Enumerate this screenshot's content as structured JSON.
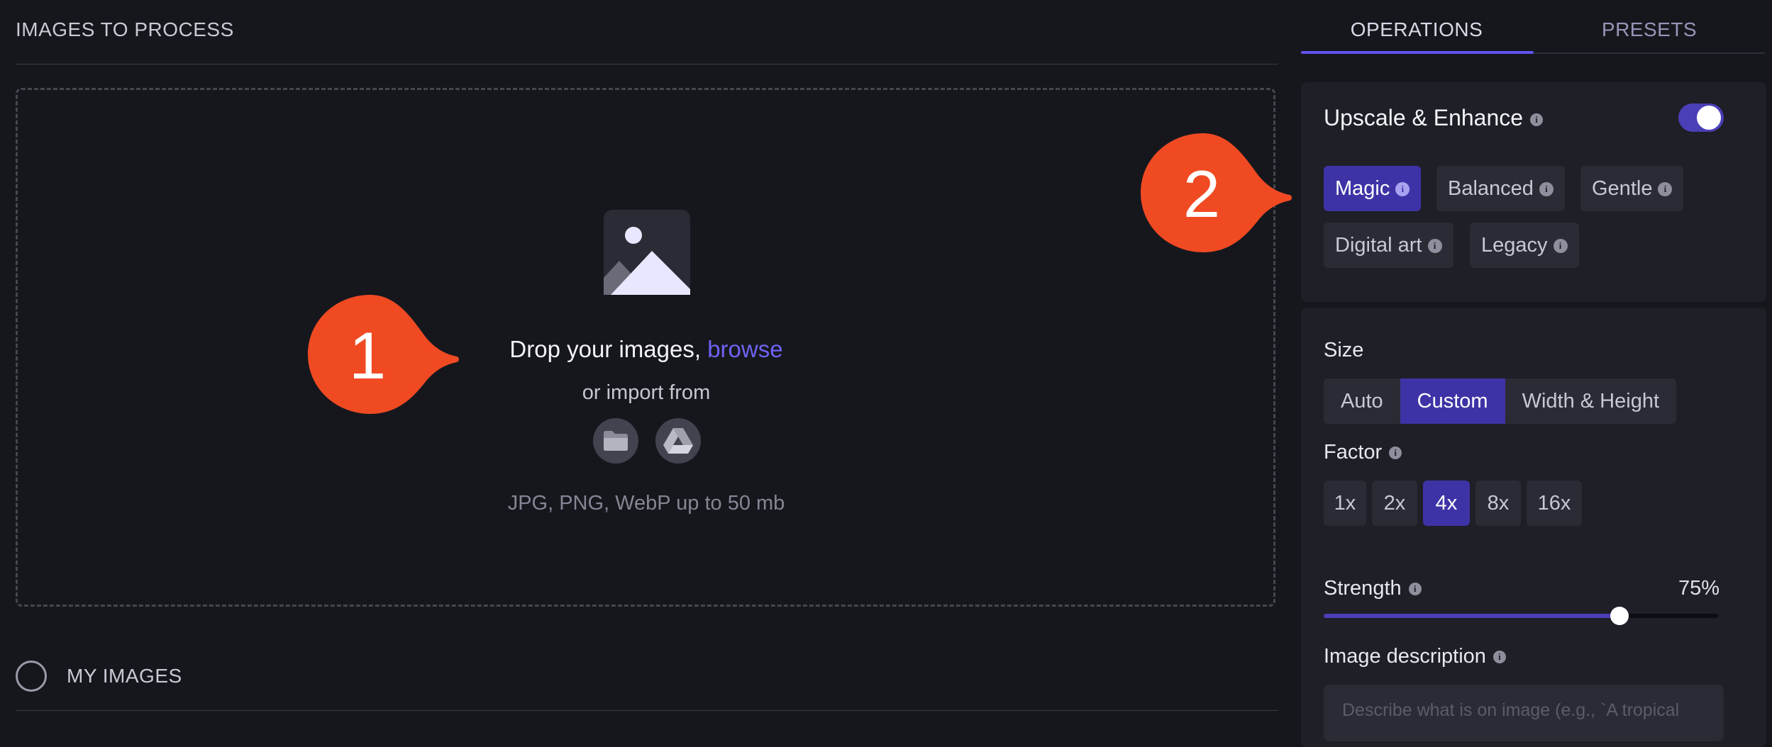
{
  "left": {
    "title": "IMAGES TO PROCESS",
    "dropzone": {
      "drop_text": "Drop your images, ",
      "browse_link": "browse",
      "import_text": "or import from",
      "formats": "JPG, PNG, WebP up to 50 mb"
    },
    "my_images": "MY IMAGES"
  },
  "tabs": [
    {
      "label": "OPERATIONS",
      "active": true
    },
    {
      "label": "PRESETS",
      "active": false
    }
  ],
  "upscale": {
    "title": "Upscale & Enhance",
    "enabled": true,
    "modes": [
      {
        "label": "Magic",
        "active": true
      },
      {
        "label": "Balanced",
        "active": false
      },
      {
        "label": "Gentle",
        "active": false
      },
      {
        "label": "Digital art",
        "active": false
      },
      {
        "label": "Legacy",
        "active": false
      }
    ]
  },
  "size": {
    "label": "Size",
    "options": [
      {
        "label": "Auto",
        "active": false
      },
      {
        "label": "Custom",
        "active": true
      },
      {
        "label": "Width & Height",
        "active": false
      }
    ]
  },
  "factor": {
    "label": "Factor",
    "options": [
      {
        "label": "1x",
        "active": false
      },
      {
        "label": "2x",
        "active": false
      },
      {
        "label": "4x",
        "active": true
      },
      {
        "label": "8x",
        "active": false
      },
      {
        "label": "16x",
        "active": false
      }
    ]
  },
  "strength": {
    "label": "Strength",
    "value_text": "75%",
    "value": 75
  },
  "image_description": {
    "label": "Image description",
    "placeholder": "Describe what is on image (e.g., `A tropical"
  },
  "callouts": [
    "1",
    "2"
  ],
  "colors": {
    "accent": "#3e33a6",
    "link": "#6f63f3",
    "callout": "#f04a23",
    "background": "#16171d"
  }
}
